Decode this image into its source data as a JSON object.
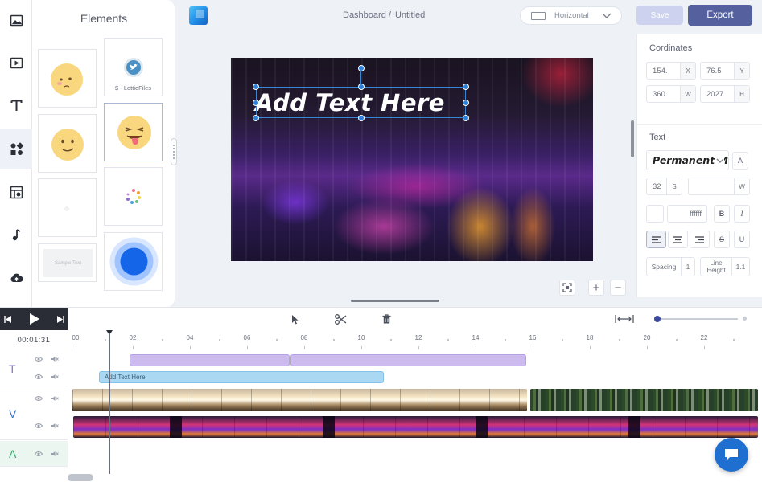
{
  "sidebar": {
    "items": [
      {
        "name": "image-icon",
        "active": false
      },
      {
        "name": "video-icon",
        "active": false
      },
      {
        "name": "text-icon",
        "active": false
      },
      {
        "name": "elements-icon",
        "active": true
      },
      {
        "name": "media-library-icon",
        "active": false
      },
      {
        "name": "music-icon",
        "active": false
      },
      {
        "name": "upload-cloud-icon",
        "active": false
      }
    ]
  },
  "elements_panel": {
    "title": "Elements",
    "lottie_caption": "$ - LottieFiles",
    "sample_text": "Sample Text"
  },
  "header": {
    "breadcrumb_link": "Dashboard /",
    "breadcrumb_current": "Untitled",
    "orientation": "Horizontal",
    "save_label": "Save",
    "export_label": "Export",
    "accent": "#55609f"
  },
  "canvas": {
    "text": "Add Text Here"
  },
  "properties": {
    "coordinates_title": "Cordinates",
    "x_value": "154.",
    "x_unit": "X",
    "y_value": "76.5",
    "y_unit": "Y",
    "w_value": "360.",
    "w_unit": "W",
    "h_value": "2027",
    "h_unit": "H",
    "text_title": "Text",
    "font_name": "Permanent Marker",
    "font_unit": "A",
    "size_value": "32",
    "size_unit": "S",
    "weight_unit": "W",
    "color_hex": "ffffff",
    "bold": "B",
    "italic": "I",
    "strike": "S",
    "underline": "U",
    "spacing_label": "Spacing",
    "spacing_value": "1",
    "line_height_label_1": "Line",
    "line_height_label_2": "Height",
    "line_height_value": "1.1"
  },
  "timeline": {
    "time": "00:01:31",
    "ticks": [
      "00",
      "02",
      "04",
      "06",
      "08",
      "10",
      "12",
      "14",
      "16",
      "18",
      "20",
      "22"
    ],
    "tracks": [
      {
        "letter": "T",
        "color": "#8a72c9"
      },
      {
        "letter": "V",
        "color": "#3b6fd1"
      },
      {
        "letter": "A",
        "color": "#3aa36b"
      }
    ],
    "text_clip_label": "Add Text Here"
  }
}
